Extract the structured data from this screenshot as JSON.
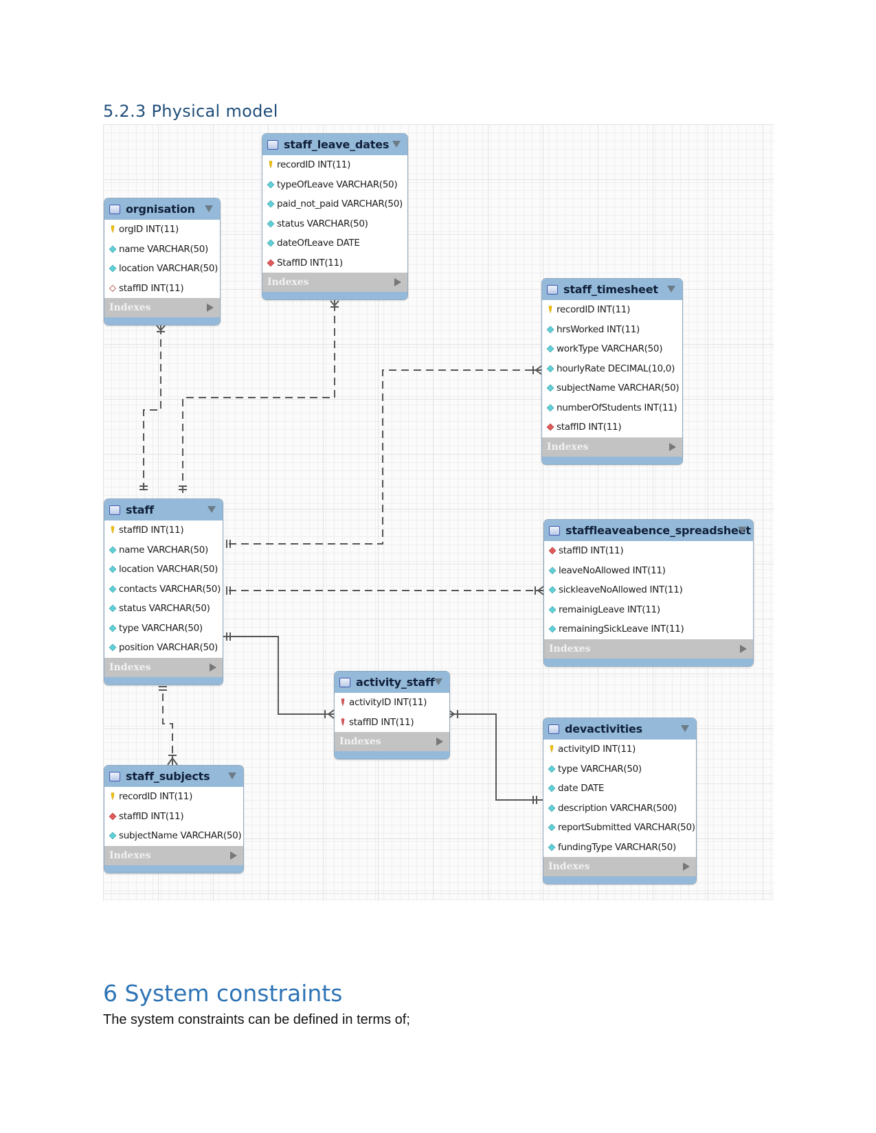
{
  "document": {
    "section_heading": "5.2.3 Physical model",
    "next_heading": "6 System constraints",
    "paragraph": "The system constraints can be defined in terms of;"
  },
  "diagram": {
    "indexes_label": "Indexes",
    "tables": {
      "orgnisation": {
        "name": "orgnisation",
        "columns": [
          {
            "text": "orgID INT(11)",
            "icon": "primary-key"
          },
          {
            "text": "name VARCHAR(50)",
            "icon": "column"
          },
          {
            "text": "location VARCHAR(50)",
            "icon": "column"
          },
          {
            "text": "staffID INT(11)",
            "icon": "nullable-column"
          }
        ]
      },
      "staff_leave_dates": {
        "name": "staff_leave_dates",
        "columns": [
          {
            "text": "recordID INT(11)",
            "icon": "primary-key"
          },
          {
            "text": "typeOfLeave VARCHAR(50)",
            "icon": "column"
          },
          {
            "text": "paid_not_paid VARCHAR(50)",
            "icon": "column"
          },
          {
            "text": "status VARCHAR(50)",
            "icon": "column"
          },
          {
            "text": "dateOfLeave DATE",
            "icon": "column"
          },
          {
            "text": "StaffID INT(11)",
            "icon": "foreign-key"
          }
        ]
      },
      "staff_timesheet": {
        "name": "staff_timesheet",
        "columns": [
          {
            "text": "recordID INT(11)",
            "icon": "primary-key"
          },
          {
            "text": "hrsWorked INT(11)",
            "icon": "column"
          },
          {
            "text": "workType VARCHAR(50)",
            "icon": "column"
          },
          {
            "text": "hourlyRate DECIMAL(10,0)",
            "icon": "column"
          },
          {
            "text": "subjectName VARCHAR(50)",
            "icon": "column"
          },
          {
            "text": "numberOfStudents INT(11)",
            "icon": "column"
          },
          {
            "text": "staffID INT(11)",
            "icon": "foreign-key"
          }
        ]
      },
      "staff": {
        "name": "staff",
        "columns": [
          {
            "text": "staffID INT(11)",
            "icon": "primary-key"
          },
          {
            "text": "name VARCHAR(50)",
            "icon": "column"
          },
          {
            "text": "location VARCHAR(50)",
            "icon": "column"
          },
          {
            "text": "contacts VARCHAR(50)",
            "icon": "column"
          },
          {
            "text": "status VARCHAR(50)",
            "icon": "column"
          },
          {
            "text": "type VARCHAR(50)",
            "icon": "column"
          },
          {
            "text": "position VARCHAR(50)",
            "icon": "column"
          }
        ]
      },
      "staffleaveabence_spreadsheet": {
        "name": "staffleaveabence_spreadsheet",
        "columns": [
          {
            "text": "staffID INT(11)",
            "icon": "foreign-key"
          },
          {
            "text": "leaveNoAllowed INT(11)",
            "icon": "column"
          },
          {
            "text": "sickleaveNoAllowed INT(11)",
            "icon": "column"
          },
          {
            "text": "remainigLeave INT(11)",
            "icon": "column"
          },
          {
            "text": "remainingSickLeave INT(11)",
            "icon": "column"
          }
        ]
      },
      "activity_staff": {
        "name": "activity_staff",
        "columns": [
          {
            "text": "activityID INT(11)",
            "icon": "primary-foreign-key"
          },
          {
            "text": "staffID INT(11)",
            "icon": "primary-foreign-key"
          }
        ]
      },
      "devactivities": {
        "name": "devactivities",
        "columns": [
          {
            "text": "activityID INT(11)",
            "icon": "primary-key"
          },
          {
            "text": "type VARCHAR(50)",
            "icon": "column"
          },
          {
            "text": "date DATE",
            "icon": "column"
          },
          {
            "text": "description VARCHAR(500)",
            "icon": "column"
          },
          {
            "text": "reportSubmitted VARCHAR(50)",
            "icon": "column"
          },
          {
            "text": "fundingType VARCHAR(50)",
            "icon": "column"
          }
        ]
      },
      "staff_subjects": {
        "name": "staff_subjects",
        "columns": [
          {
            "text": "recordID INT(11)",
            "icon": "primary-key"
          },
          {
            "text": "staffID INT(11)",
            "icon": "foreign-key"
          },
          {
            "text": "subjectName VARCHAR(50)",
            "icon": "column"
          }
        ]
      }
    },
    "relationships": [
      {
        "from": "staff",
        "to": "orgnisation",
        "from_card": "one-and-only-one",
        "to_card": "one-or-many",
        "style": "non-identifying"
      },
      {
        "from": "staff",
        "to": "staff_leave_dates",
        "from_card": "one-and-only-one",
        "to_card": "one-or-many",
        "style": "non-identifying"
      },
      {
        "from": "staff",
        "to": "staff_timesheet",
        "from_card": "one-and-only-one",
        "to_card": "one-or-many",
        "style": "non-identifying"
      },
      {
        "from": "staff",
        "to": "staffleaveabence_spreadsheet",
        "from_card": "one-and-only-one",
        "to_card": "one-or-many",
        "style": "non-identifying"
      },
      {
        "from": "staff",
        "to": "activity_staff",
        "from_card": "one-and-only-one",
        "to_card": "one-or-many",
        "style": "identifying"
      },
      {
        "from": "devactivities",
        "to": "activity_staff",
        "from_card": "one-and-only-one",
        "to_card": "one-or-many",
        "style": "identifying"
      },
      {
        "from": "staff",
        "to": "staff_subjects",
        "from_card": "one-and-only-one",
        "to_card": "one-or-many",
        "style": "non-identifying"
      }
    ],
    "colors": {
      "header": "#95bad9",
      "indexes_bar": "#c3c3c3",
      "primary_key": "#f2c200",
      "column": "#5fd0d8",
      "foreign_key": "#e05a5a",
      "link": "#555555"
    }
  }
}
